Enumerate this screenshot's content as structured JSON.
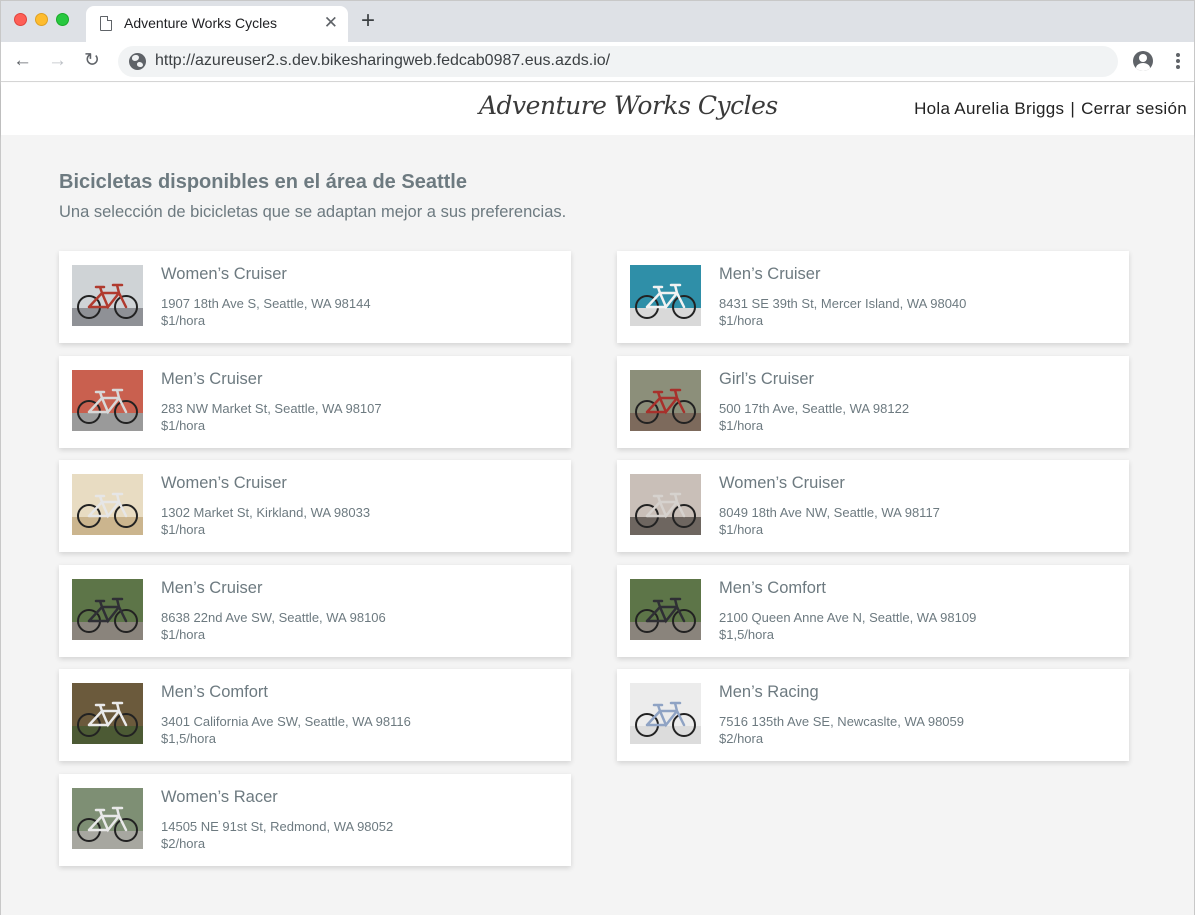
{
  "browser": {
    "tab_title": "Adventure Works Cycles",
    "tab_close": "✕",
    "new_tab": "+",
    "url": "http://azureuser2.s.dev.bikesharingweb.fedcab0987.eus.azds.io/",
    "back": "←",
    "forward": "→",
    "reload": "↻"
  },
  "header": {
    "logo": "Adventure Works Cycles",
    "greeting": "Hola Aurelia Briggs",
    "separator": "|",
    "logout": "Cerrar sesión"
  },
  "main": {
    "title": "Bicicletas disponibles en el área de Seattle",
    "subtitle": "Una selección de bicicletas que se adaptan mejor a sus preferencias.",
    "bikes": [
      {
        "name": "Women’s Cruiser",
        "address": "1907 18th Ave S, Seattle, WA 98144",
        "price": "$1/hora",
        "bg": "#cfd3d6",
        "ground": "#8f9196",
        "frame": "#b03a2e"
      },
      {
        "name": "Men’s Cruiser",
        "address": "8431 SE 39th St, Mercer Island, WA 98040",
        "price": "$1/hora",
        "bg": "#2f8fa8",
        "ground": "#d9d9d9",
        "frame": "#f2f2f2"
      },
      {
        "name": "Men’s Cruiser",
        "address": "283 NW Market St, Seattle, WA 98107",
        "price": "$1/hora",
        "bg": "#c9604f",
        "ground": "#9a9a9a",
        "frame": "#d8d8d8"
      },
      {
        "name": "Girl’s Cruiser",
        "address": "500 17th Ave, Seattle, WA 98122",
        "price": "$1/hora",
        "bg": "#8c8f7a",
        "ground": "#7d6a5c",
        "frame": "#a8302b"
      },
      {
        "name": "Women’s Cruiser",
        "address": "1302 Market St, Kirkland, WA 98033",
        "price": "$1/hora",
        "bg": "#e8dcc2",
        "ground": "#cbb58e",
        "frame": "#e6e6e6"
      },
      {
        "name": "Women’s Cruiser",
        "address": "8049 18th Ave NW, Seattle, WA 98117",
        "price": "$1/hora",
        "bg": "#c9bfb8",
        "ground": "#6e6660",
        "frame": "#d6d2ce"
      },
      {
        "name": "Men’s Cruiser",
        "address": "8638 22nd Ave SW, Seattle, WA 98106",
        "price": "$1/hora",
        "bg": "#5d7548",
        "ground": "#8a847c",
        "frame": "#2f2f35"
      },
      {
        "name": "Men’s Comfort",
        "address": "2100 Queen Anne Ave N, Seattle, WA 98109",
        "price": "$1,5/hora",
        "bg": "#5d7548",
        "ground": "#8a847c",
        "frame": "#2f2f35"
      },
      {
        "name": "Men’s Comfort",
        "address": "3401 California Ave SW, Seattle, WA 98116",
        "price": "$1,5/hora",
        "bg": "#6b5a3c",
        "ground": "#4c5a34",
        "frame": "#eaeaea"
      },
      {
        "name": "Men’s Racing",
        "address": "7516 135th Ave SE, Newcaslte, WA 98059",
        "price": "$2/hora",
        "bg": "#ececec",
        "ground": "#dcdcdc",
        "frame": "#8fa3c4"
      },
      {
        "name": "Women’s Racer",
        "address": "14505 NE 91st St, Redmond, WA 98052",
        "price": "$2/hora",
        "bg": "#7e8f74",
        "ground": "#a7a7a0",
        "frame": "#e9e9e9"
      }
    ]
  }
}
